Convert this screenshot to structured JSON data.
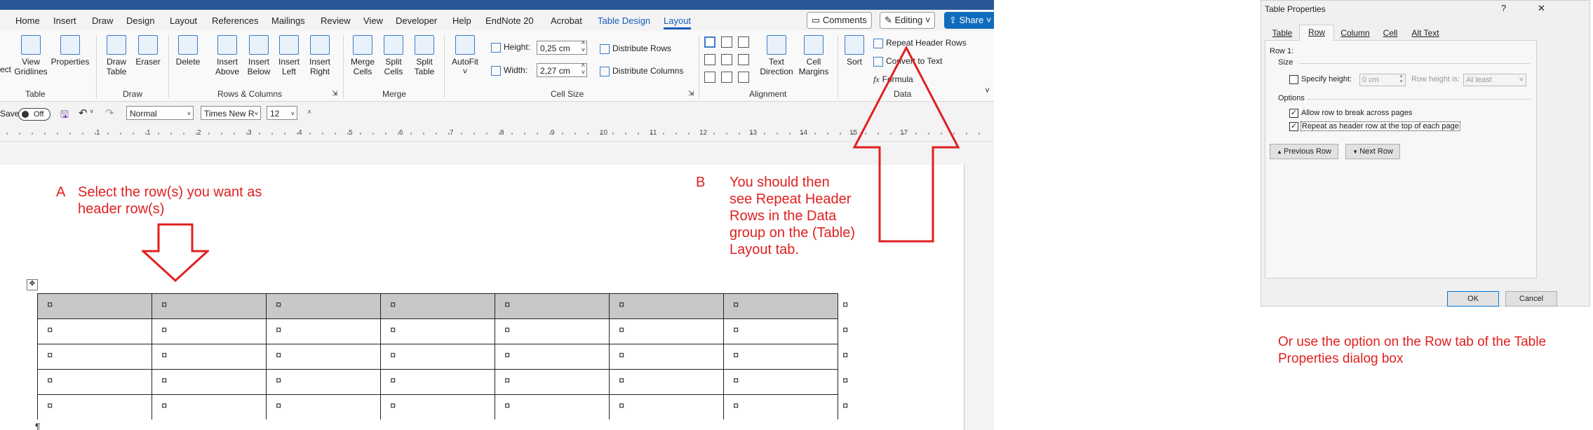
{
  "word": {
    "tabs": [
      "Home",
      "Insert",
      "Draw",
      "Design",
      "Layout",
      "References",
      "Mailings",
      "Review",
      "View",
      "Developer",
      "Help",
      "EndNote 20",
      "Acrobat",
      "Table Design",
      "Layout"
    ],
    "comments_label": "Comments",
    "editing_label": "Editing",
    "share_label": "Share",
    "ribbon": {
      "table_group": {
        "select_label": "ect",
        "gridlines_label": "View Gridlines",
        "properties_label": "Properties",
        "group_label": "Table"
      },
      "draw_group": {
        "draw_table_label": "Draw Table",
        "eraser_label": "Eraser",
        "group_label": "Draw"
      },
      "rows_cols_group": {
        "delete_label": "Delete",
        "insert_above_label": "Insert Above",
        "insert_below_label": "Insert Below",
        "insert_left_label": "Insert Left",
        "insert_right_label": "Insert Right",
        "group_label": "Rows & Columns"
      },
      "merge_group": {
        "merge_cells_label": "Merge Cells",
        "split_cells_label": "Split Cells",
        "split_table_label": "Split Table",
        "group_label": "Merge"
      },
      "cell_size_group": {
        "autofit_label": "AutoFit",
        "height_label": "Height:",
        "height_value": "0,25 cm",
        "width_label": "Width:",
        "width_value": "2,27 cm",
        "distribute_rows_label": "Distribute Rows",
        "distribute_cols_label": "Distribute Columns",
        "group_label": "Cell Size"
      },
      "alignment_group": {
        "text_direction_label": "Text Direction",
        "cell_margins_label": "Cell Margins",
        "group_label": "Alignment"
      },
      "data_group": {
        "sort_label": "Sort",
        "repeat_header_label": "Repeat Header Rows",
        "convert_label": "Convert to Text",
        "formula_label": "Formula",
        "group_label": "Data"
      }
    },
    "qat": {
      "save_label": "Save",
      "autosave_state": "Off",
      "style_value": "Normal",
      "font_value": "Times New R",
      "size_value": "12"
    },
    "ruler_numbers": [
      "1",
      "1",
      "2",
      "3",
      "4",
      "5",
      "6",
      "7",
      "8",
      "9",
      "10",
      "11",
      "12",
      "13",
      "14",
      "15",
      "17"
    ],
    "cell_marker": "¤",
    "paragraph_mark": "¶"
  },
  "annotations": {
    "a_letter": "A",
    "a_text": "Select the row(s) you want as header row(s)",
    "b_letter": "B",
    "b_text": "You should then see Repeat Header Rows in the Data group on the (Table) Layout tab.",
    "c_text": "Or use the option on the Row tab of the Table Properties dialog box"
  },
  "dialog": {
    "title": "Table Properties",
    "help_glyph": "?",
    "close_glyph": "✕",
    "tabs": [
      "Table",
      "Row",
      "Column",
      "Cell",
      "Alt Text"
    ],
    "row_heading": "Row 1:",
    "size_heading": "Size",
    "specify_height_label": "Specify height:",
    "height_value": "0 cm",
    "row_height_is_label": "Row height is:",
    "row_height_is_value": "At least",
    "options_heading": "Options",
    "allow_break_label": "Allow row to break across pages",
    "repeat_header_label": "Repeat as header row at the top of each page",
    "previous_row_label": "Previous Row",
    "next_row_label": "Next Row",
    "ok_label": "OK",
    "cancel_label": "Cancel"
  },
  "colors": {
    "accent": "#185abd",
    "annotation": "#e02020",
    "header_shade": "#c8c8c8",
    "share": "#0f6cbd"
  }
}
